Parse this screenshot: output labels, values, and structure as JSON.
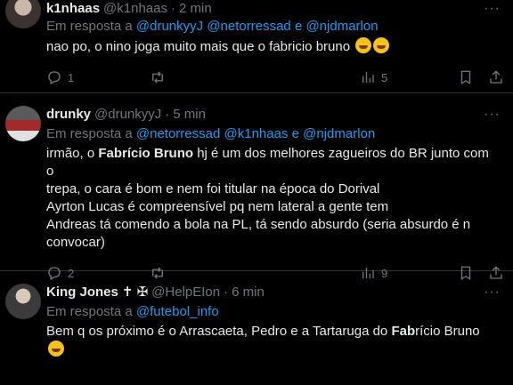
{
  "tweets": [
    {
      "name": "k1nhaas",
      "handle": "@k1nhaas",
      "time": "2 min",
      "reply_prefix": "Em resposta a",
      "mentions": [
        "@drunkyyJ",
        "@netorressad",
        "e",
        "@njdmarlon"
      ],
      "text": "nao po, o nino joga muito mais que o fabricio bruno",
      "replies": "1",
      "reposts": "",
      "views": "5"
    },
    {
      "name": "drunky",
      "handle": "@drunkyyJ",
      "time": "5 min",
      "reply_prefix": "Em resposta a",
      "mentions": [
        "@netorressad",
        "@k1nhaas",
        "e",
        "@njdmarlon"
      ],
      "text_line1_a": "irmão, o ",
      "text_line1_bold": "Fabrício Bruno",
      "text_line1_b": " hj é um dos melhores zagueiros do BR junto com o",
      "text_line2": "trepa, o cara é bom e nem foi titular na época do Dorival",
      "text_line3": "Ayrton Lucas é compreensível pq nem lateral a gente tem",
      "text_line4": "Andreas tá comendo a bola na PL, tá sendo absurdo (seria absurdo é n",
      "text_line5": "convocar)",
      "replies": "2",
      "reposts": "",
      "views": "9"
    },
    {
      "name": "King Jones",
      "name_symbols": "✝ ✠",
      "handle": "@HelpEIon",
      "time": "6 min",
      "reply_prefix": "Em resposta a",
      "mentions": [
        "@futebol_info"
      ],
      "text_a": "Bem q os próximo é o Arrascaeta, Pedro e a Tartaruga do ",
      "text_bold": "Fab",
      "text_b": "rício Bruno"
    }
  ],
  "dot": "·",
  "more": "···",
  "colors": {
    "accent": "#1d9bf0",
    "muted": "#71767b",
    "bg": "#000000",
    "divider": "#2f3336"
  },
  "icons": [
    "reply-icon",
    "repost-icon",
    "like-icon",
    "views-icon",
    "bookmark-icon",
    "share-icon",
    "more-icon"
  ]
}
